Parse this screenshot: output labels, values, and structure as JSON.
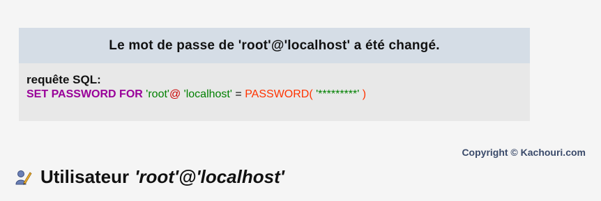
{
  "message": {
    "title": "Le mot de passe de 'root'@'localhost' a été changé.",
    "sql_label": "requête SQL:",
    "sql": {
      "keyword": "SET PASSWORD FOR",
      "user": "'root'",
      "at": "@",
      "host": "'localhost'",
      "equals": "=",
      "function": "PASSWORD(",
      "value": "'*********'",
      "close": ")"
    }
  },
  "copyright": "Copyright © Kachouri.com",
  "heading": {
    "label": "Utilisateur",
    "user": "'root'@'localhost'",
    "icon": "user-edit-icon"
  },
  "colors": {
    "keyword": "#990099",
    "string": "#008000",
    "function": "#ff3300",
    "header_bg": "#d5dde6",
    "body_bg": "#e8e8e8"
  }
}
